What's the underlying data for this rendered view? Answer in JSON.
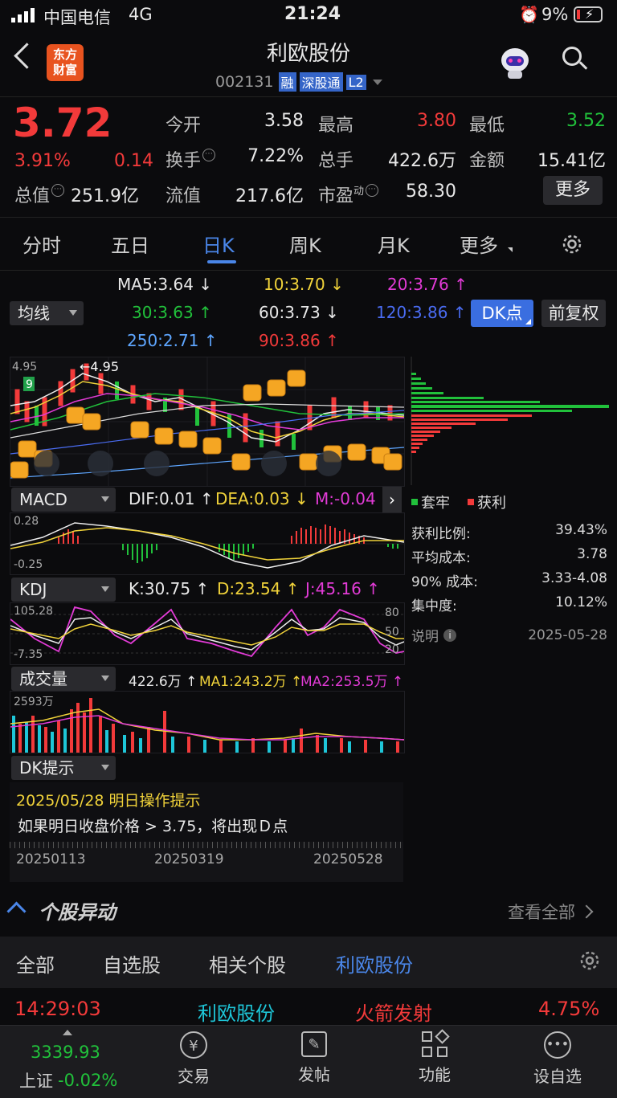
{
  "status_bar": {
    "carrier": "中国电信",
    "network": "4G",
    "time": "21:24",
    "battery": "9%"
  },
  "header": {
    "app_logo": "东方\n财富",
    "title": "利欧股份",
    "code": "002131",
    "badges": [
      "融",
      "深股通",
      "L2"
    ]
  },
  "quote": {
    "price": "3.72",
    "change_pct": "3.91%",
    "change": "0.14",
    "open_label": "今开",
    "open": "3.58",
    "high_label": "最高",
    "high": "3.80",
    "low_label": "最低",
    "low": "3.52",
    "turnover_label": "换手",
    "turnover": "7.22%",
    "volume_label": "总手",
    "volume": "422.6万",
    "amount_label": "金额",
    "amount": "15.41亿",
    "mktcap_label": "总值",
    "mktcap": "251.9亿",
    "float_label": "流值",
    "float": "217.6亿",
    "pe_label": "市盈",
    "pe_sup": "动",
    "pe": "58.30",
    "more_label": "更多"
  },
  "tabs": [
    "分时",
    "五日",
    "日K",
    "周K",
    "月K",
    "更多"
  ],
  "ma": {
    "selector": "均线",
    "ma5": "MA5:3.64",
    "ma10": "10:3.70",
    "ma20": "20:3.76",
    "ma30": "30:3.63",
    "ma60": "60:3.73",
    "ma120": "120:3.86",
    "ma250": "250:2.71",
    "ma90": "90:3.86",
    "dk_button": "DK点",
    "fq_button": "前复权"
  },
  "kline": {
    "high_label": "4.95",
    "high_arrow": "←4.95",
    "left_axis_top": "4.95"
  },
  "chips": {
    "legend_trapped": "套牢",
    "legend_profit": "获利",
    "rows": [
      {
        "label": "获利比例:",
        "value": "39.43%"
      },
      {
        "label": "平均成本:",
        "value": "3.78"
      },
      {
        "label": "90% 成本:",
        "value": "3.33-4.08"
      },
      {
        "label": "集中度:",
        "value": "10.12%"
      }
    ],
    "note_label": "说明",
    "note_date": "2025-05-28"
  },
  "macd": {
    "selector": "MACD",
    "dif": "DIF:0.01",
    "dea": "DEA:0.03",
    "m": "M:-0.04",
    "top": "0.28",
    "bottom": "-0.25"
  },
  "kdj": {
    "selector": "KDJ",
    "k": "K:30.75",
    "d": "D:23.54",
    "j": "J:45.16",
    "top": "105.28",
    "bottom": "-7.35",
    "r80": "80",
    "r50": "50",
    "r20": "20"
  },
  "vol": {
    "selector": "成交量",
    "vol": "422.6万",
    "ma1": "MA1:243.2万",
    "ma2": "MA2:253.5万",
    "top": "2593万"
  },
  "dk": {
    "selector": "DK提示",
    "title": "2025/05/28 明日操作提示",
    "text": "如果明日收盘价格 > 3.75，将出现Ｄ点"
  },
  "dates": [
    "20250113",
    "20250319",
    "20250528"
  ],
  "news": {
    "title": "个股异动",
    "view_all": "查看全部"
  },
  "subtabs": [
    "全部",
    "自选股",
    "相关个股",
    "利欧股份"
  ],
  "ticker_row": {
    "time": "14:29:03",
    "name": "利欧股份",
    "event": "火箭发射",
    "pct": "4.75%"
  },
  "bottom": {
    "index_value": "3339.93",
    "index_name": "上证",
    "index_change": "-0.02%",
    "items": [
      "交易",
      "发帖",
      "功能",
      "设自选"
    ]
  },
  "colors": {
    "up": "#f23a3a",
    "down": "#21c13b",
    "accent": "#4a86e8"
  }
}
